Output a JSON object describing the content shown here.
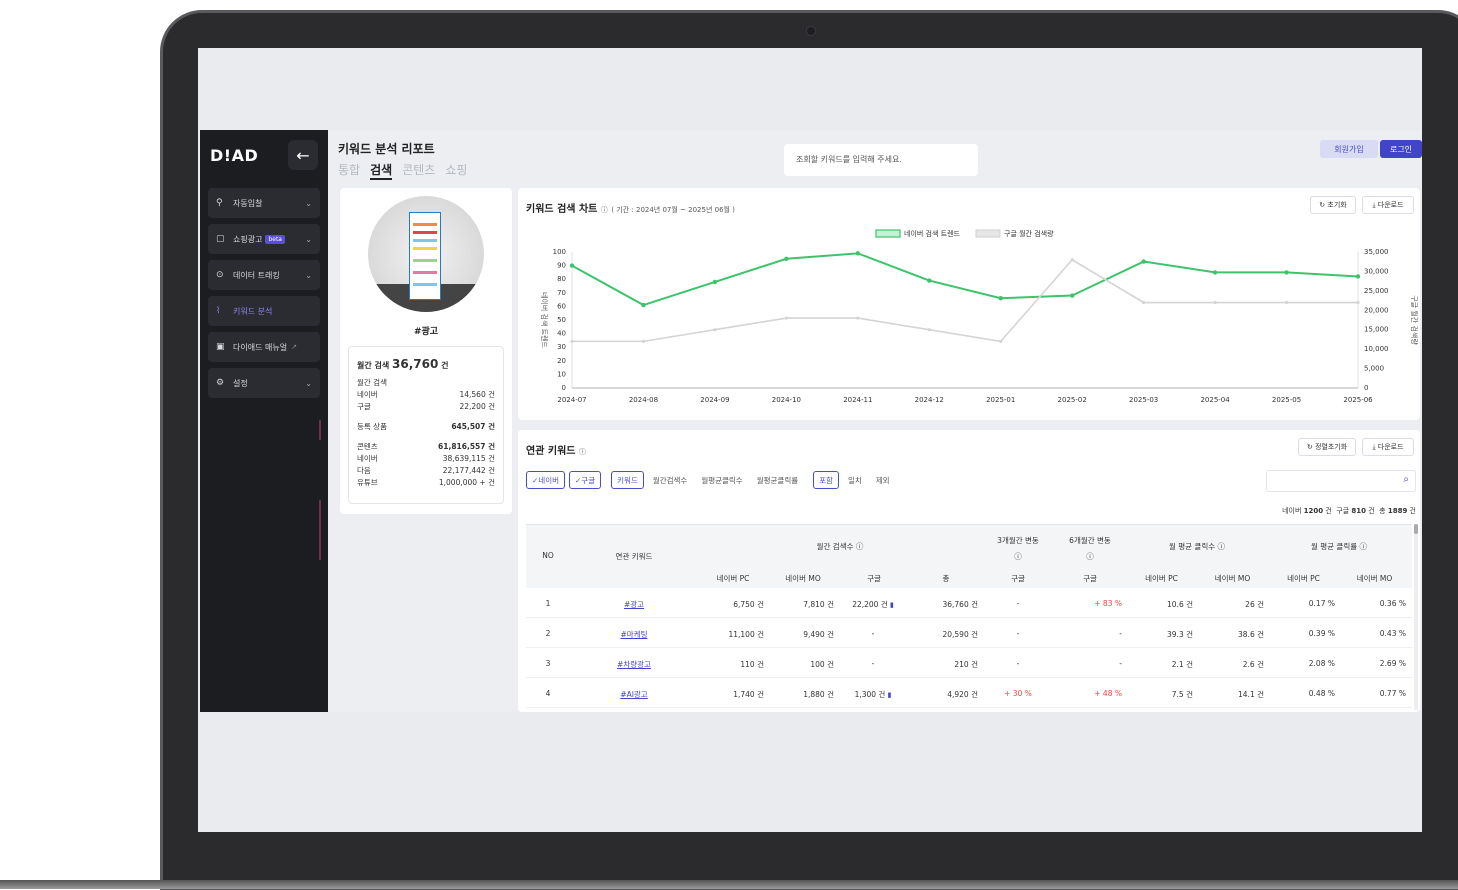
{
  "sidebar": {
    "logo": "D!AD",
    "back_icon": "←",
    "items": [
      {
        "label": "자동입찰",
        "icon": "bid-icon",
        "has_chevron": true
      },
      {
        "label": "쇼핑광고",
        "icon": "bag-icon",
        "badge": "beta",
        "has_chevron": true
      },
      {
        "label": "데이터 트래킹",
        "icon": "tracking-icon",
        "has_chevron": true
      },
      {
        "label": "키워드 분석",
        "icon": "chart-icon",
        "active": true
      },
      {
        "label": "다이애드 매뉴얼",
        "icon": "manual-icon"
      },
      {
        "label": "설정",
        "icon": "gear-icon",
        "has_chevron": true
      }
    ]
  },
  "header": {
    "title": "키워드 분석 리포트",
    "tabs": [
      "통합",
      "검색",
      "콘텐츠",
      "쇼핑"
    ],
    "active_tab": "검색",
    "search_placeholder": "조회할 키워드를 입력해 주세요.",
    "signup": "회원가입",
    "login": "로그인"
  },
  "profile": {
    "keyword": "#광고",
    "monthly_label": "월간 검색",
    "monthly_total": "36,760",
    "unit": "건",
    "monthly_sub": "월간 검색",
    "naver_label": "네이버",
    "naver": "14,560 건",
    "google_label": "구글",
    "google": "22,200 건",
    "products_label": "등록 상품",
    "products": "645,507 건",
    "content_label": "콘텐츠",
    "content": "61,816,557 건",
    "c_naver_label": "네이버",
    "c_naver": "38,639,115 건",
    "c_daum_label": "다음",
    "c_daum": "22,177,442 건",
    "c_youtube_label": "유튜브",
    "c_youtube": "1,000,000 + 건"
  },
  "chart": {
    "title": "키워드 검색 차트",
    "period": "( 기간 : 2024년 07월 ~ 2025년 06월 )",
    "reset": "초기화",
    "download": "다운로드",
    "legend_naver": "네이버 검색 트렌드",
    "legend_google": "구글 월간 검색량",
    "left_axis_label": "네이버 검색 트렌드",
    "right_axis_label": "구글 월간 검색량"
  },
  "chart_data": {
    "type": "line",
    "x": [
      "2024-07",
      "2024-08",
      "2024-09",
      "2024-10",
      "2024-11",
      "2024-12",
      "2025-01",
      "2025-02",
      "2025-03",
      "2025-04",
      "2025-05",
      "2025-06"
    ],
    "series": [
      {
        "name": "네이버 검색 트렌드",
        "axis": "left",
        "color": "#3cc46a",
        "values": [
          90,
          61,
          78,
          95,
          99,
          79,
          66,
          68,
          93,
          85,
          85,
          82
        ]
      },
      {
        "name": "구글 월간 검색량",
        "axis": "right",
        "color": "#d4d4d4",
        "values": [
          12000,
          12000,
          15000,
          18000,
          18000,
          15000,
          12000,
          33000,
          22000,
          22000,
          22000,
          22000
        ]
      }
    ],
    "left_ticks": [
      0,
      10,
      20,
      30,
      40,
      50,
      60,
      70,
      80,
      90,
      100
    ],
    "right_ticks": [
      "0",
      "5,000",
      "10,000",
      "15,000",
      "20,000",
      "25,000",
      "30,000",
      "35,000"
    ],
    "ylim_left": [
      0,
      100
    ],
    "ylim_right": [
      0,
      35000
    ],
    "legend_position": "top-center"
  },
  "keywords": {
    "title": "연관 키워드",
    "reset_sort": "정렬초기화",
    "download": "다운로드",
    "filters": {
      "naver": "네이버",
      "google": "구글",
      "keyword": "키워드",
      "monthly": "월간검색수",
      "avg_click": "월평균클릭수",
      "avg_rate": "월평균클릭률",
      "include": "포함",
      "match": "일치",
      "exclude": "제외"
    },
    "counts": {
      "naver_label": "네이버",
      "naver": "1200",
      "google_label": "구글",
      "google": "810",
      "total_label": "총",
      "total": "1889",
      "unit": "건"
    },
    "headers": {
      "no": "NO",
      "keyword": "연관 키워드",
      "monthly": "월간 검색수",
      "change3": "3개월간 변동",
      "change6": "6개월간 변동",
      "avg_click": "월 평균 클릭수",
      "avg_rate": "월 평균 클릭률",
      "naver_pc": "네이버 PC",
      "naver_mo": "네이버 MO",
      "google": "구글",
      "total": "총"
    },
    "rows": [
      {
        "no": "1",
        "kw": "#광고",
        "npc": "6,750 건",
        "nmo": "7,810 건",
        "google": "22,200 건",
        "total": "36,760 건",
        "c3": "-",
        "c6": "+ 83 %",
        "cpc": "10.6 건",
        "cmo": "26 건",
        "rpc": "0.17 %",
        "rmo": "0.36 %"
      },
      {
        "no": "2",
        "kw": "#마케팅",
        "npc": "11,100 건",
        "nmo": "9,490 건",
        "google": "-",
        "total": "20,590 건",
        "c3": "-",
        "c6": "-",
        "cpc": "39.3 건",
        "cmo": "38.6 건",
        "rpc": "0.39 %",
        "rmo": "0.43 %"
      },
      {
        "no": "3",
        "kw": "#차량광고",
        "npc": "110 건",
        "nmo": "100 건",
        "google": "-",
        "total": "210 건",
        "c3": "-",
        "c6": "-",
        "cpc": "2.1 건",
        "cmo": "2.6 건",
        "rpc": "2.08 %",
        "rmo": "2.69 %"
      },
      {
        "no": "4",
        "kw": "#AI광고",
        "npc": "1,740 건",
        "nmo": "1,880 건",
        "google": "1,300 건",
        "total": "4,920 건",
        "c3": "+ 30 %",
        "c6": "+ 48 %",
        "cpc": "7.5 건",
        "cmo": "14.1 건",
        "rpc": "0.48 %",
        "rmo": "0.77 %"
      }
    ]
  }
}
